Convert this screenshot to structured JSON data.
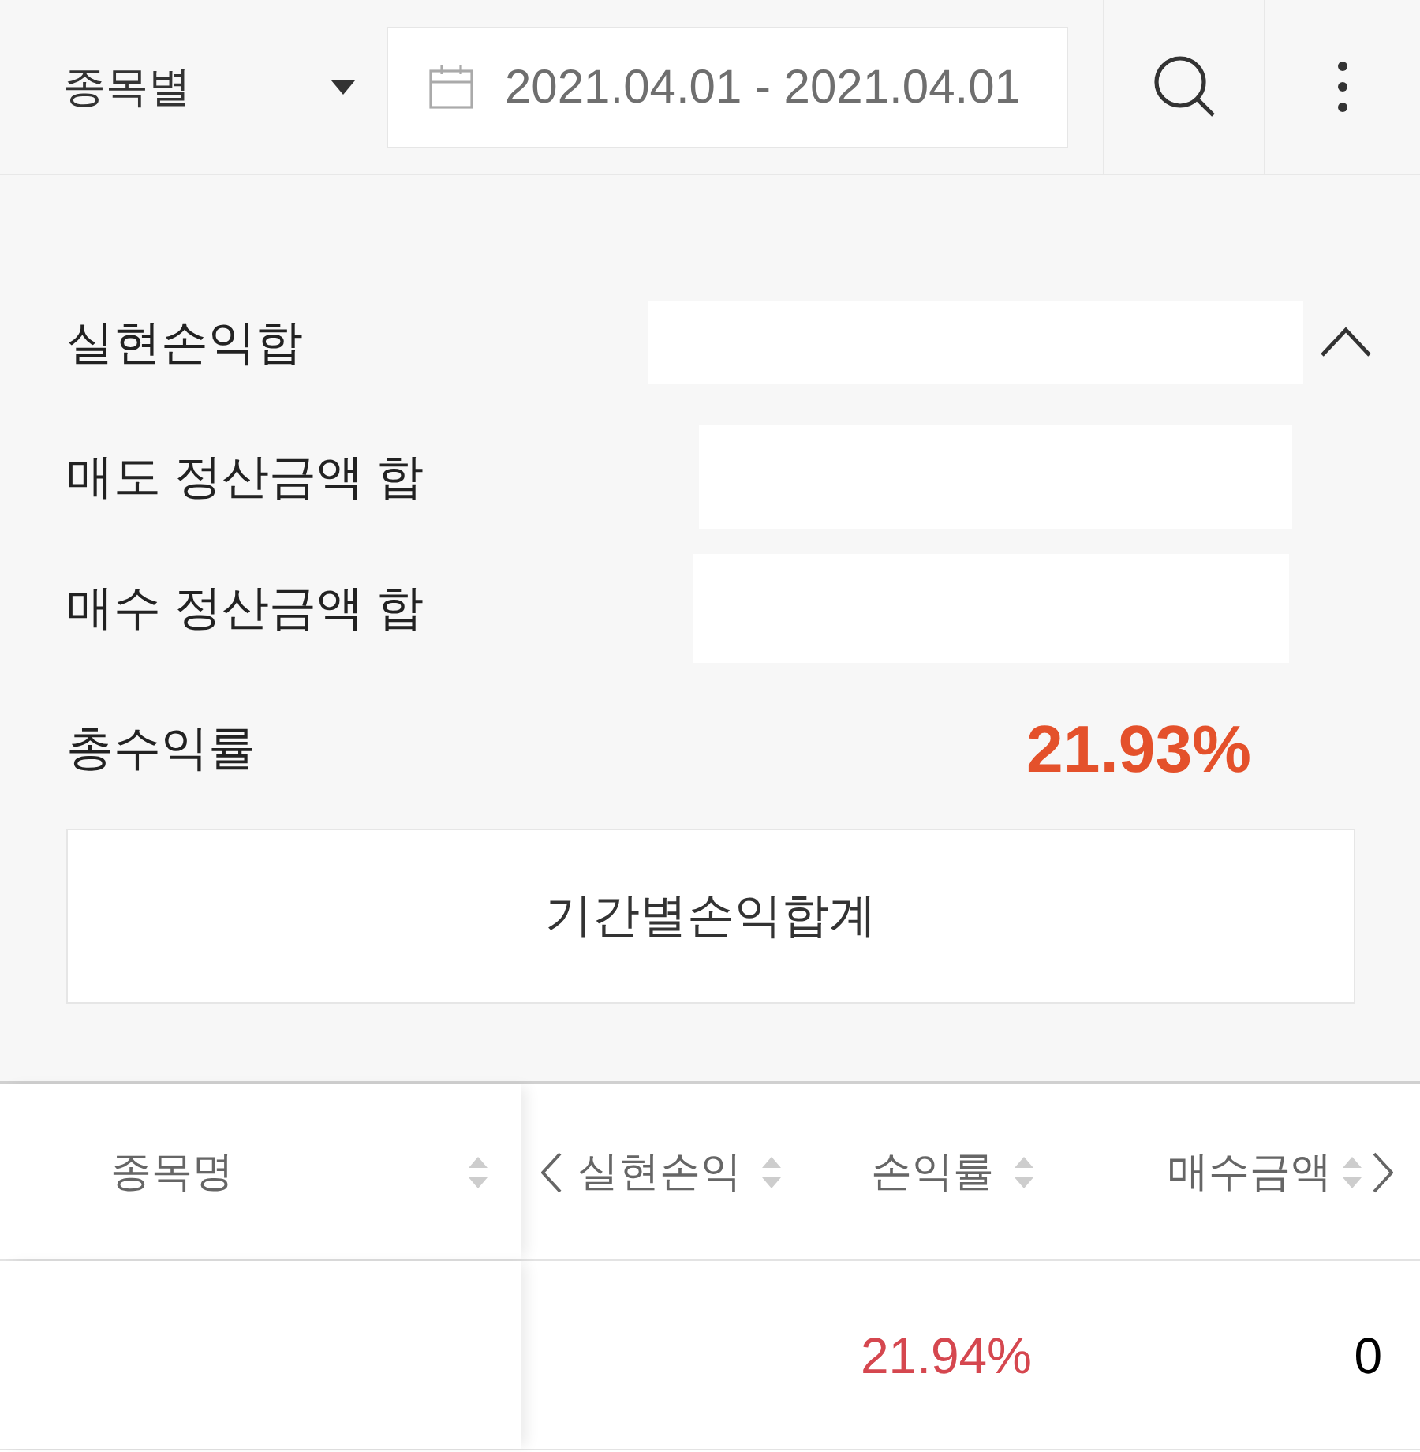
{
  "toolbar": {
    "filter": {
      "value": "종목별"
    },
    "date_range": {
      "value": "2021.04.01 - 2021.04.01"
    }
  },
  "summary": {
    "expanded": true,
    "rows": [
      {
        "label": "실현손익합"
      },
      {
        "label": "매도 정산금액 합"
      },
      {
        "label": "매수 정산금액 합"
      },
      {
        "label": "총수익률",
        "value": "21.93%"
      }
    ],
    "button": "기간별손익합계"
  },
  "table": {
    "scroll_left": true,
    "scroll_right": true,
    "columns": [
      {
        "label": "종목명",
        "fixed": true
      },
      {
        "label": "실현손익",
        "fixed": false
      },
      {
        "label": "손익률",
        "fixed": false
      },
      {
        "label": "매수금액",
        "fixed": false
      }
    ],
    "rows": [
      {
        "cells": [
          null,
          null,
          "21.94%",
          "0"
        ]
      }
    ]
  }
}
